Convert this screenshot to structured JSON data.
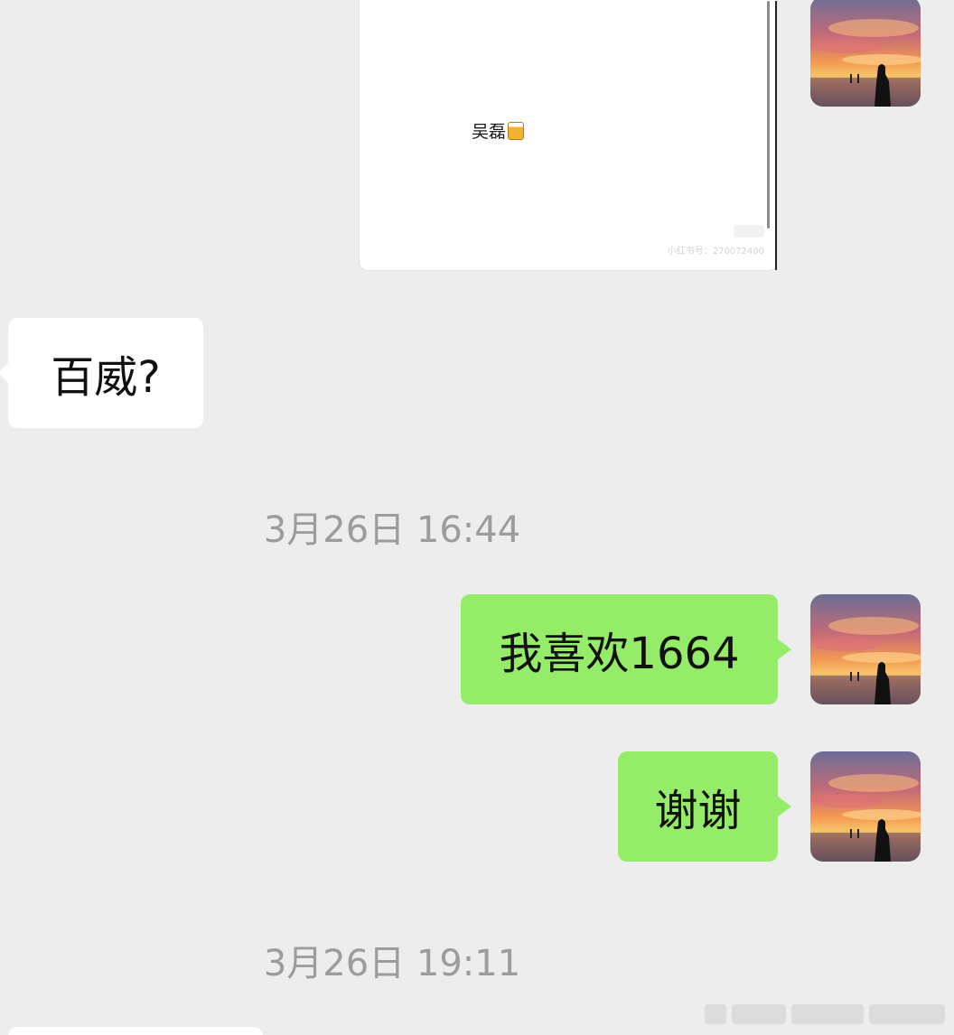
{
  "messages": {
    "shared_image": {
      "text": "吴磊",
      "watermark": "小红书号：270072400"
    },
    "incoming_1": {
      "text": "百威?"
    },
    "timestamp_1": "3月26日 16:44",
    "outgoing_1": {
      "text": "我喜欢1664"
    },
    "outgoing_2": {
      "text": "谢谢"
    },
    "timestamp_2": "3月26日 19:11"
  },
  "icons": {
    "avatar": "sunset-silhouette-avatar",
    "emoji": "beer-mug-icon"
  },
  "colors": {
    "background": "#ededed",
    "incoming_bubble": "#ffffff",
    "outgoing_bubble": "#95ec69",
    "timestamp": "#9c9c9c"
  }
}
